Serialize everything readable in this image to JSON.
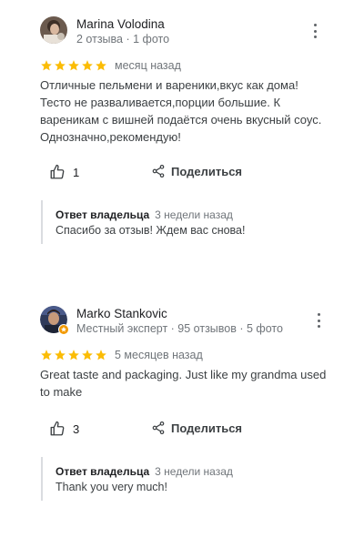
{
  "reviews": [
    {
      "author": "Marina Volodina",
      "meta": "2 отзыва · 1 фото",
      "stars": 5,
      "when": "месяц назад",
      "text": "Отличные пельмени и вареники,вкус как дома! Тесто не разваливается,порции большие. К вареникам с вишней подаётся очень вкусный соус. Однозначно,рекомендую!",
      "likes": "1",
      "share_label": "Поделиться",
      "owner_reply": {
        "title": "Ответ владельца",
        "when": "3 недели назад",
        "text": "Спасибо за отзыв! Ждем вас снова!"
      }
    },
    {
      "author": "Marko Stankovic",
      "meta": "Местный эксперт · 95 отзывов · 5 фото",
      "stars": 5,
      "when": "5 месяцев назад",
      "text": "Great taste and packaging. Just like my grandma used to make",
      "likes": "3",
      "share_label": "Поделиться",
      "owner_reply": {
        "title": "Ответ владельца",
        "when": "3 недели назад",
        "text": "Thank you very much!"
      }
    }
  ],
  "colors": {
    "star": "#fbbc04",
    "meta": "#70757a",
    "divider": "#dadce0",
    "local_guide_badge": "#f29900"
  }
}
